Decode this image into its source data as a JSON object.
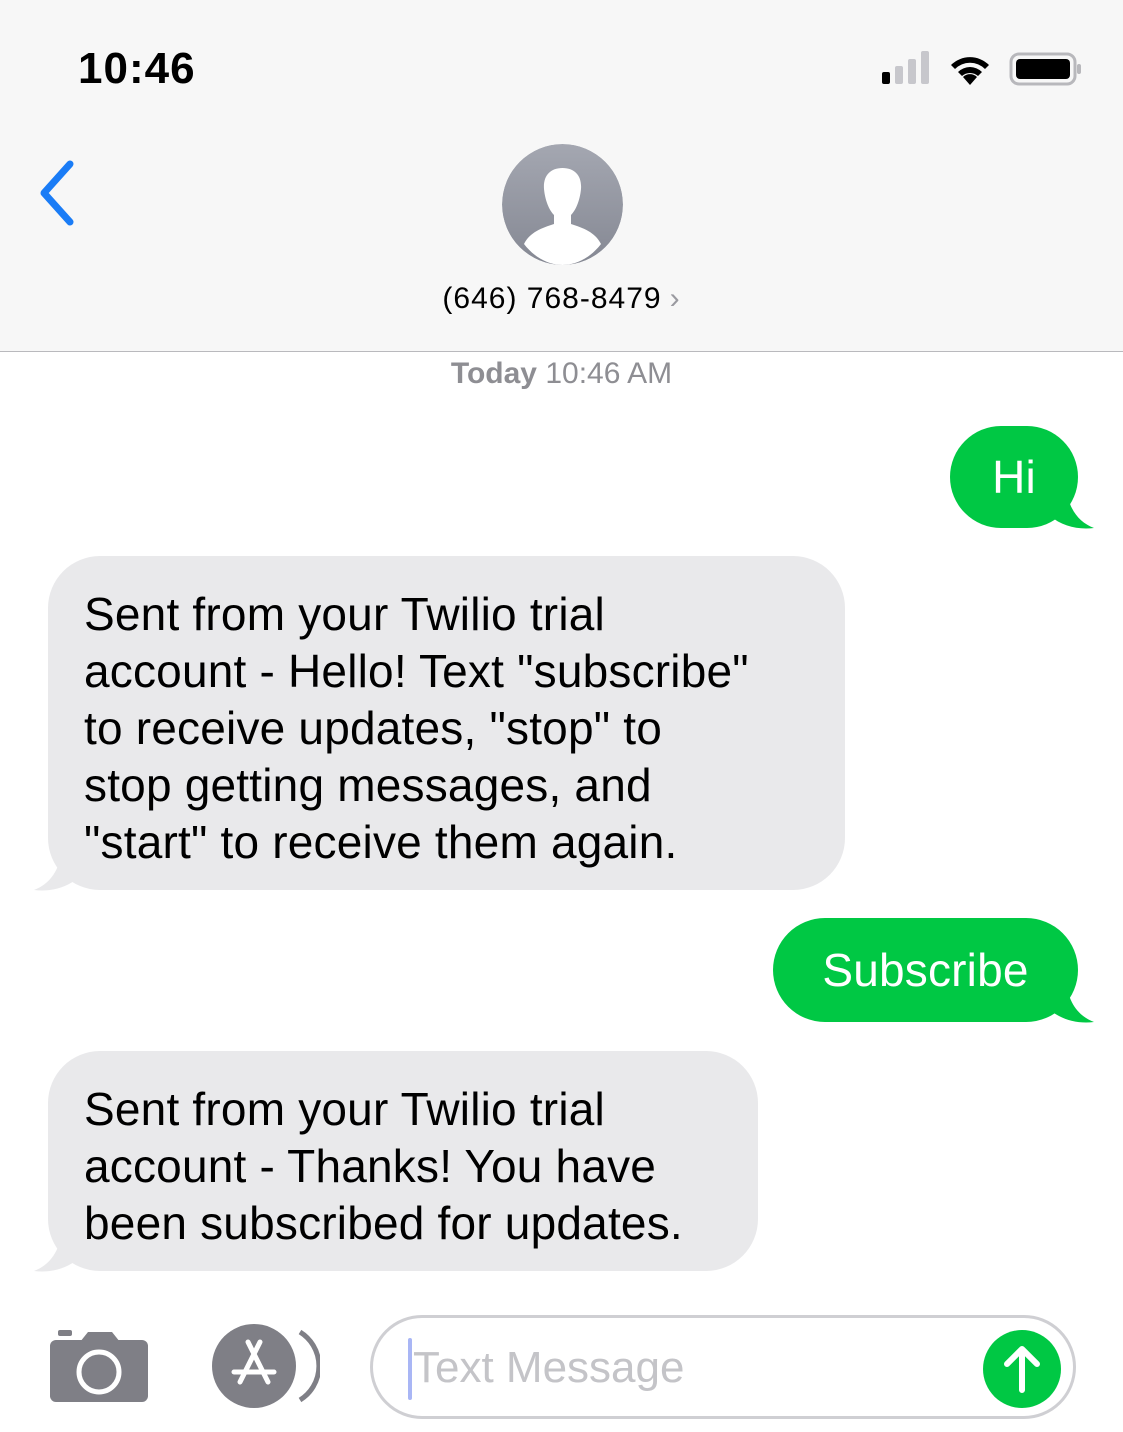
{
  "status_bar": {
    "time": "10:46"
  },
  "header": {
    "contact": "(646) 768-8479",
    "contact_chevron": "›"
  },
  "conversation": {
    "timestamp_day": "Today",
    "timestamp_time": "10:46 AM",
    "messages": [
      {
        "direction": "sent",
        "text": "Hi"
      },
      {
        "direction": "received",
        "text": "Sent from your Twilio trial\naccount - Hello! Text \"subscribe\"\nto receive updates, \"stop\" to\nstop getting messages, and\n\"start\" to receive them again."
      },
      {
        "direction": "sent",
        "text": "Subscribe"
      },
      {
        "direction": "received",
        "text": "Sent from your Twilio trial\naccount - Thanks! You have\nbeen subscribed for updates."
      }
    ]
  },
  "composer": {
    "placeholder": "Text Message"
  },
  "colors": {
    "sent_bubble": "#00c844",
    "received_bubble": "#e9e9eb",
    "accent_blue": "#1a7cf6",
    "header_bg": "#f7f7f7"
  },
  "icons": {
    "back": "chevron-left-icon",
    "avatar": "person-silhouette-icon",
    "camera": "camera-icon",
    "apps": "app-store-icon",
    "send": "arrow-up-icon",
    "signal": "cellular-signal-icon",
    "wifi": "wifi-icon",
    "battery": "battery-icon"
  }
}
